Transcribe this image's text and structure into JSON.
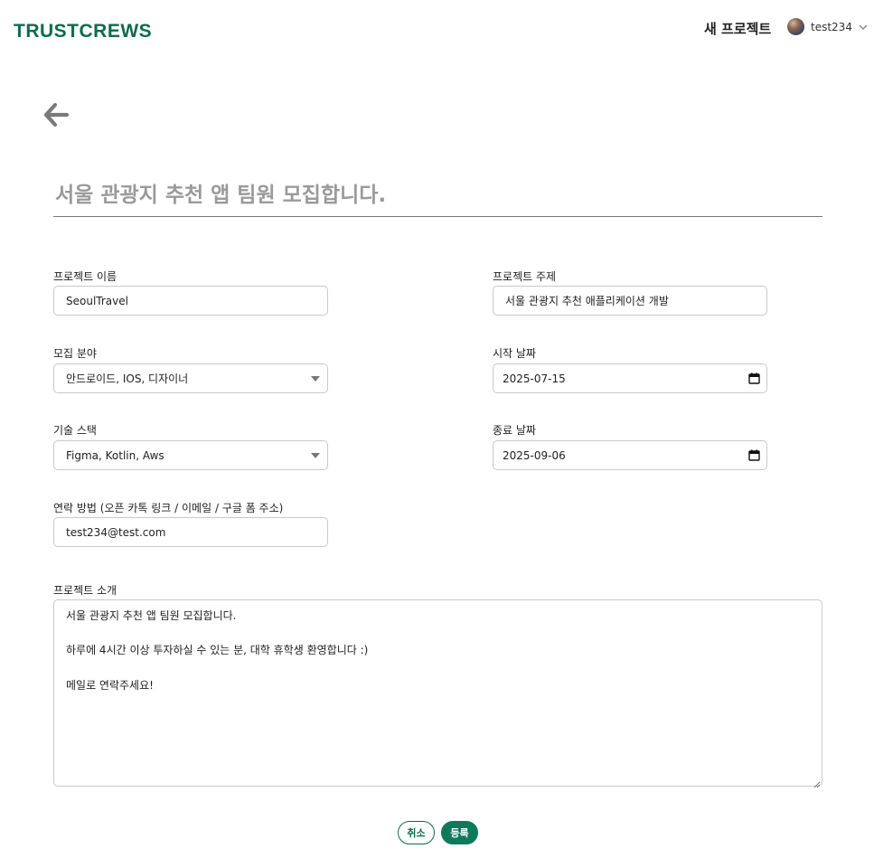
{
  "header": {
    "logo": "TRUSTCREWS",
    "new_project": "새 프로젝트",
    "username": "test234"
  },
  "form": {
    "title_placeholder": "서울 관광지 추천 앱 팀원 모집합니다.",
    "project_name": {
      "label": "프로젝트 이름",
      "value": "SeoulTravel"
    },
    "project_topic": {
      "label": "프로젝트 주제",
      "value": "서울 관광지 추천 애플리케이션 개발"
    },
    "recruit_field": {
      "label": "모집 분야",
      "value": "안드로이드, IOS, 디자이너"
    },
    "start_date": {
      "label": "시작 날짜",
      "value": "2025-07-15"
    },
    "tech_stack": {
      "label": "기술 스택",
      "value": "Figma, Kotlin, Aws"
    },
    "end_date": {
      "label": "종료 날짜",
      "value": "2025-09-06"
    },
    "contact": {
      "label": "연락 방법 (오픈 카톡 링크 / 이메일 / 구글 폼 주소)",
      "value": "test234@test.com"
    },
    "intro": {
      "label": "프로젝트 소개",
      "lines": [
        "서울 관광지 추천 앱 팀원 모집합니다.",
        "",
        "하루에 4시간 이상 투자하실 수 있는 분, 대학 휴학생 환영합니다 :)",
        "",
        "메일로 연락주세요!"
      ]
    },
    "cancel_label": "취소",
    "submit_label": "등록"
  },
  "icons": {
    "back": "arrow-left-icon",
    "avatar": "user-avatar",
    "dropdown": "chevron-down-icon",
    "calendar": "calendar-icon"
  },
  "colors": {
    "brand": "#0f6b4e",
    "submit": "#0f7a5a"
  }
}
